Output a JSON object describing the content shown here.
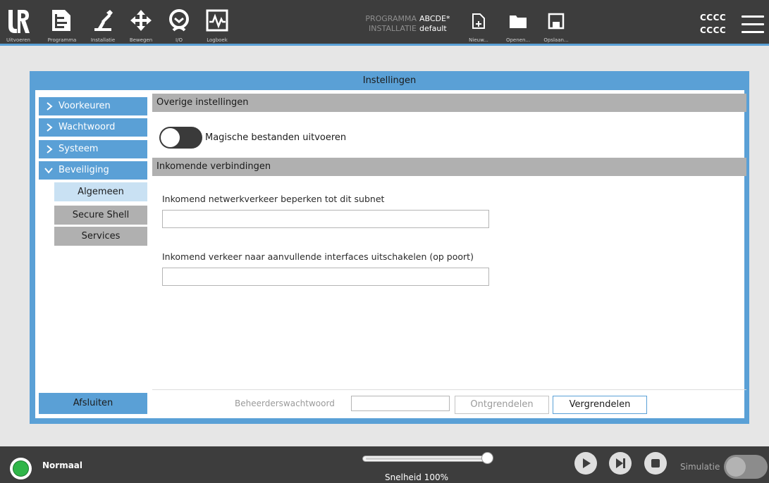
{
  "topbar": {
    "nav": [
      {
        "label": "Uitvoeren",
        "icon": "ur-logo-icon"
      },
      {
        "label": "Programma",
        "icon": "program-tree-icon"
      },
      {
        "label": "Installatie",
        "icon": "robot-arm-icon"
      },
      {
        "label": "Bewegen",
        "icon": "move-arrows-icon"
      },
      {
        "label": "I/O",
        "icon": "io-icon"
      },
      {
        "label": "Logboek",
        "icon": "log-chart-icon"
      }
    ],
    "program_key": "PROGRAMMA",
    "program_value": "ABCDE*",
    "install_key": "INSTALLATIE",
    "install_value": "default",
    "file_buttons": [
      {
        "label": "Nieuw...",
        "icon": "new-file-icon"
      },
      {
        "label": "Openen...",
        "icon": "folder-icon"
      },
      {
        "label": "Opslaan...",
        "icon": "save-icon"
      }
    ],
    "right_line1": "CCCC",
    "right_line2": "CCCC"
  },
  "dialog": {
    "title": "Instellingen",
    "sidebar": {
      "items": [
        {
          "label": "Voorkeuren",
          "expanded": false
        },
        {
          "label": "Wachtwoord",
          "expanded": false
        },
        {
          "label": "Systeem",
          "expanded": false
        },
        {
          "label": "Beveiliging",
          "expanded": true
        }
      ],
      "subitems": [
        {
          "label": "Algemeen",
          "active": true
        },
        {
          "label": "Secure Shell",
          "active": false
        },
        {
          "label": "Services",
          "active": false
        }
      ],
      "exit_label": "Afsluiten"
    },
    "content": {
      "section1_title": "Overige instellingen",
      "toggle_label": "Magische bestanden uitvoeren",
      "toggle_on": false,
      "section2_title": "Inkomende verbindingen",
      "subnet_label": "Inkomend netwerkverkeer beperken tot dit subnet",
      "subnet_value": "",
      "interfaces_label": "Inkomend verkeer naar aanvullende interfaces uitschakelen (op poort)",
      "interfaces_value": ""
    },
    "footer": {
      "password_label": "Beheerderswachtwoord",
      "password_value": "",
      "unlock_label": "Ontgrendelen",
      "lock_label": "Vergrendelen"
    }
  },
  "bottombar": {
    "status": "Normaal",
    "status_color": "#2fb548",
    "speed_label": "Snelheid 100%",
    "speed_percent": 100,
    "controls": [
      "play-icon",
      "step-icon",
      "stop-icon"
    ],
    "simulation_label": "Simulatie",
    "simulation_on": false
  },
  "colors": {
    "accent": "#5aa0d6",
    "topbar": "#3d3d3d",
    "section_header": "#b0b0b0",
    "active_subitem": "#c9e1f3"
  }
}
